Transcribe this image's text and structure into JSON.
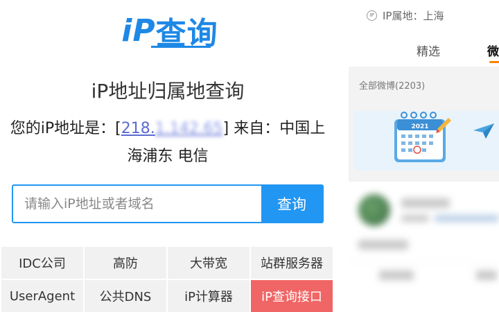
{
  "ip_page": {
    "logo": {
      "ip": "iP",
      "rest": "查询"
    },
    "title": "iP地址归属地查询",
    "ip_prefix": "您的iP地址是：[",
    "ip_visible": "218.",
    "ip_blurred": "1.142.65",
    "ip_suffix": "] 来自：中国上",
    "location_line2": "海浦东 电信",
    "search": {
      "placeholder": "请输入iP地址或者域名",
      "button": "查询"
    },
    "links": [
      "IDC公司",
      "高防",
      "大带宽",
      "站群服务器",
      "UserAgent",
      "公共DNS",
      "iP计算器",
      "iP查询接口"
    ]
  },
  "profile_pane": {
    "ip_location_label": "IP属地：上海",
    "ip_badge": "IP",
    "tabs": [
      "精选",
      "微"
    ],
    "all_posts": "全部微博(2203)",
    "banner_year": "2021",
    "accent_color": "#ff8200"
  },
  "colors": {
    "brand_blue": "#1e88e5",
    "search_blue": "#2196f3",
    "highlight_red": "#f06565"
  }
}
